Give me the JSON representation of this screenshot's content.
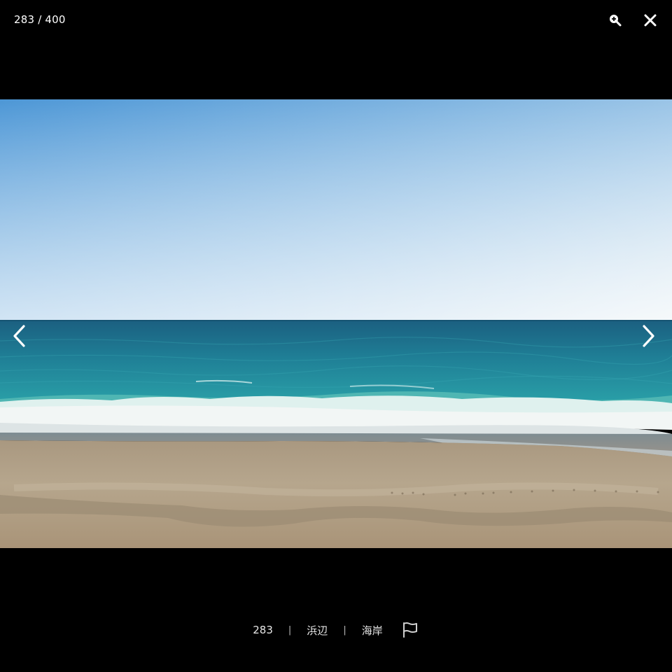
{
  "viewer": {
    "counter": "283 / 400"
  },
  "caption": {
    "number": "283",
    "separator": "|",
    "tags": [
      "浜辺",
      "海岸"
    ]
  },
  "icons": {
    "zoom": "zoom-in-icon",
    "close": "close-icon",
    "prev": "chevron-left-icon",
    "next": "chevron-right-icon",
    "flag": "flag-icon"
  },
  "colors": {
    "background": "#000000",
    "sky_top": "#4d97d6",
    "sky_horizon": "#eaf2f6",
    "sea_deep": "#1e6f8c",
    "sea_shallow": "#2a9aa6",
    "foam": "#f2f6f5",
    "sand": "#b09f85"
  }
}
